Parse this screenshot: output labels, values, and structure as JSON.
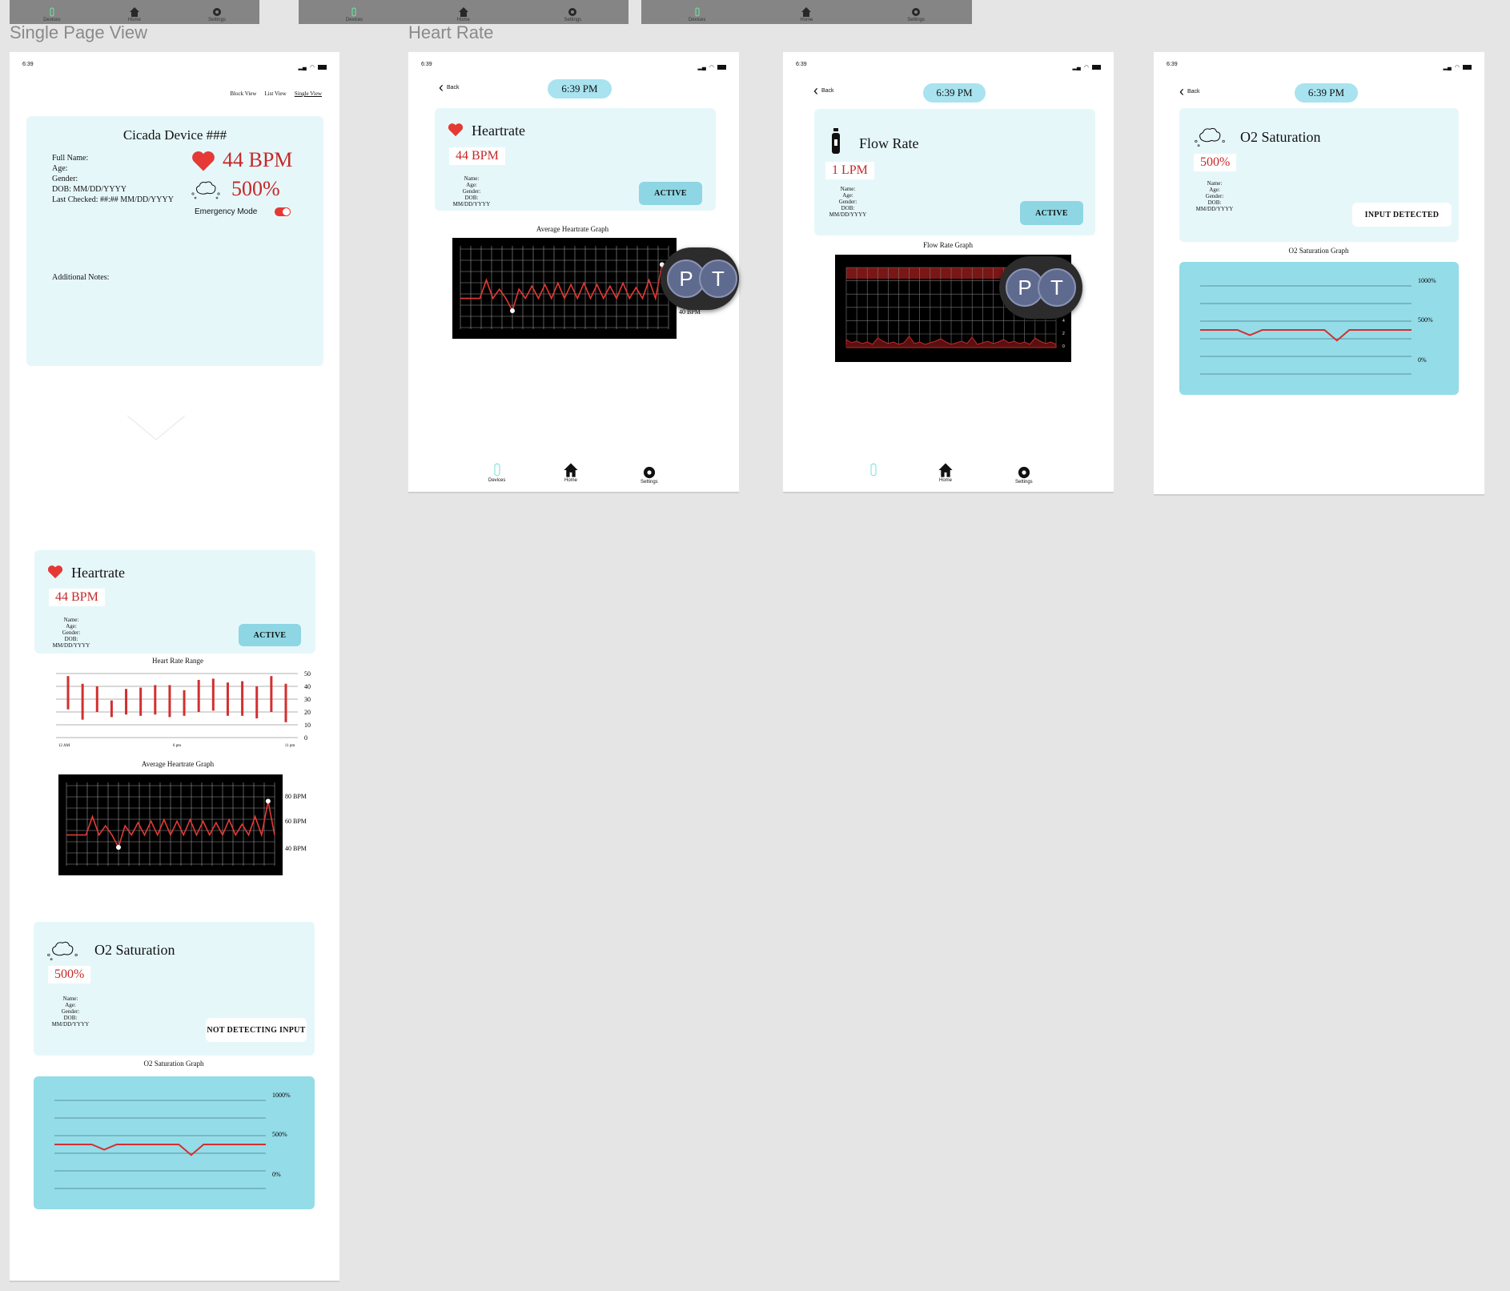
{
  "top_nav": {
    "devices": "Devices",
    "home": "Home",
    "settings": "Settings"
  },
  "labels": {
    "single_page": "Single Page View",
    "heart_rate": "Heart Rate"
  },
  "status": {
    "time": "6:39"
  },
  "single": {
    "views": [
      "Block View",
      "List View",
      "Single View"
    ],
    "device_title": "Cicada Device ###",
    "fields": [
      "Full Name:",
      "Age:",
      "Gender:",
      "DOB: MM/DD/YYYY",
      "Last Checked: ##:##  MM/DD/YYYY"
    ],
    "bpm": "44 BPM",
    "o2": "500%",
    "emergency_label": "Emergency Mode",
    "emergency_on": true,
    "notes_label": "Additional Notes:"
  },
  "hr_card": {
    "title": "Heartrate",
    "value": "44 BPM",
    "info": [
      "Name:",
      "Age:",
      "Gender:",
      "DOB: MM/DD/YYYY"
    ],
    "status": "ACTIVE"
  },
  "o2_card": {
    "title": "O2 Saturation",
    "value": "500%",
    "info": [
      "Name:",
      "Age:",
      "Gender:",
      "DOB: MM/DD/YYYY"
    ],
    "status_not": "NOT DETECTING INPUT",
    "status_yes": "INPUT DETECTED"
  },
  "flow_card": {
    "title": "Flow Rate",
    "value": "1 LPM",
    "info": [
      "Name:",
      "Age:",
      "Gender:",
      "DOB: MM/DD/YYYY"
    ],
    "status": "ACTIVE"
  },
  "graphs": {
    "range_title": "Heart Rate Range",
    "avg_title": "Average Heartrate Graph",
    "o2_title": "O2 Saturation Graph",
    "flow_title": "Flow Rate Graph"
  },
  "back": "Back",
  "time_pill": "6:39 PM",
  "avatars": [
    "P",
    "T"
  ],
  "chart_data": [
    {
      "type": "bar",
      "title": "Heart Rate Range",
      "x_ticks": [
        "12 AM",
        "6 pm",
        "11 pm"
      ],
      "ylim": [
        0,
        50
      ],
      "y_ticks": [
        0,
        10,
        20,
        30,
        40,
        50
      ],
      "ranges": [
        [
          22,
          48
        ],
        [
          14,
          42
        ],
        [
          20,
          40
        ],
        [
          16,
          29
        ],
        [
          18,
          38
        ],
        [
          17,
          39
        ],
        [
          18,
          41
        ],
        [
          16,
          41
        ],
        [
          17,
          37
        ],
        [
          20,
          45
        ],
        [
          21,
          46
        ],
        [
          17,
          43
        ],
        [
          17,
          44
        ],
        [
          15,
          40
        ],
        [
          20,
          48
        ],
        [
          12,
          42
        ]
      ]
    },
    {
      "type": "line",
      "title": "Average Heartrate Graph",
      "y_tick_labels": [
        "80 BPM",
        "60 BPM",
        "40 BPM"
      ],
      "values": [
        40,
        40,
        40,
        40,
        52,
        40,
        46,
        40,
        32,
        46,
        40,
        48,
        40,
        49,
        40,
        50,
        40,
        49,
        40,
        50,
        40,
        49,
        40,
        48,
        40,
        50,
        40,
        47,
        40,
        52,
        40,
        62,
        40
      ]
    },
    {
      "type": "line",
      "title": "O2 Saturation Graph",
      "y_tick_labels": [
        "1000%",
        "500%",
        "0%"
      ],
      "values": [
        500,
        500,
        500,
        500,
        440,
        500,
        500,
        500,
        500,
        500,
        500,
        380,
        500,
        500,
        500,
        500,
        500,
        500
      ]
    },
    {
      "type": "area",
      "title": "Flow Rate Graph",
      "y_tick_labels": [
        "6",
        "4",
        "2",
        "0"
      ]
    }
  ]
}
